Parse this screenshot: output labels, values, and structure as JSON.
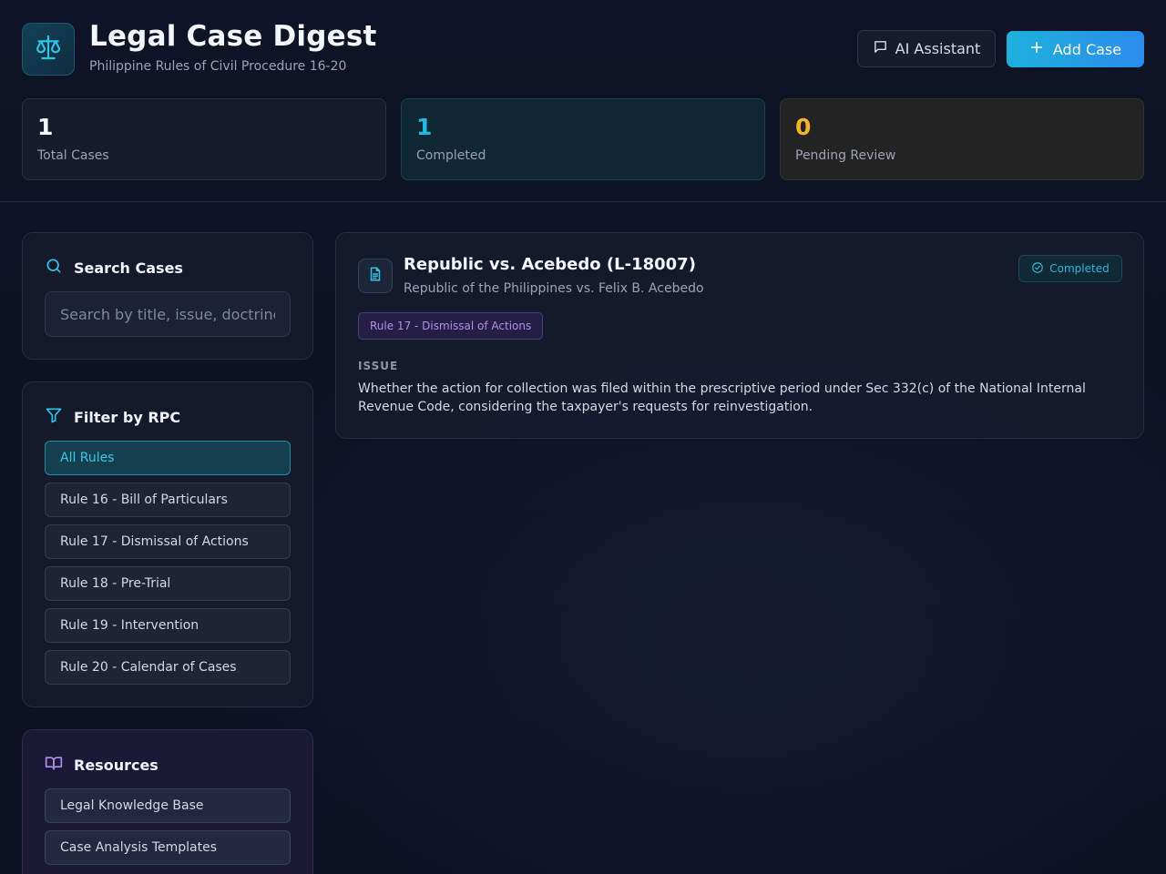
{
  "header": {
    "title": "Legal Case Digest",
    "subtitle": "Philippine Rules of Civil Procedure 16-20",
    "logo_icon": "scales-icon",
    "ai_button_label": "AI Assistant",
    "add_button_label": "Add Case"
  },
  "stats": [
    {
      "value": "1",
      "label": "Total Cases"
    },
    {
      "value": "1",
      "label": "Completed"
    },
    {
      "value": "0",
      "label": "Pending Review"
    }
  ],
  "search": {
    "title": "Search Cases",
    "placeholder": "Search by title, issue, doctrine..."
  },
  "filter": {
    "title": "Filter by RPC",
    "items": [
      {
        "label": "All Rules",
        "active": true
      },
      {
        "label": "Rule 16 - Bill of Particulars"
      },
      {
        "label": "Rule 17 - Dismissal of Actions"
      },
      {
        "label": "Rule 18 - Pre-Trial"
      },
      {
        "label": "Rule 19 - Intervention"
      },
      {
        "label": "Rule 20 - Calendar of Cases"
      }
    ]
  },
  "resources": {
    "title": "Resources",
    "items": [
      {
        "label": "Legal Knowledge Base"
      },
      {
        "label": "Case Analysis Templates"
      }
    ]
  },
  "cases": [
    {
      "title": "Republic vs. Acebedo (L-18007)",
      "parties": "Republic of the Philippines vs. Felix B. Acebedo",
      "status": "Completed",
      "rule_tag": "Rule 17 - Dismissal of Actions",
      "issue_label": "ISSUE",
      "issue": "Whether the action for collection was filed within the prescriptive period under Sec 332(c) of the National Internal Revenue Code, considering the taxpayer's requests for reinvestigation."
    }
  ],
  "colors": {
    "accent": "#22b8e0",
    "pending": "#f1b52b",
    "tag": "#b08ef0"
  }
}
